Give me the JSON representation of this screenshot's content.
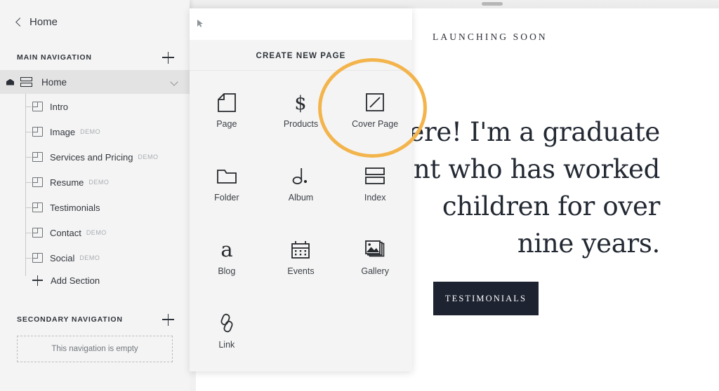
{
  "preview": {
    "eyebrow": "LAUNCHING SOON",
    "hero_lines": [
      "ere! I'm a graduate",
      "nt who has worked",
      " children for over",
      " nine years."
    ],
    "cta_label": "TESTIMONIALS",
    "cta_bg": "#1d2330"
  },
  "sidebar": {
    "back_label": "Home",
    "main_nav_title": "MAIN NAVIGATION",
    "add_main_nav_icon": "plus-icon",
    "home_item": {
      "label": "Home",
      "home_icon": "home-icon",
      "type_icon": "index-icon",
      "chevron": "chevron-down-icon"
    },
    "pages": [
      {
        "label": "Intro",
        "badge": ""
      },
      {
        "label": "Image",
        "badge": "DEMO"
      },
      {
        "label": "Services and Pricing",
        "badge": "DEMO"
      },
      {
        "label": "Resume",
        "badge": "DEMO"
      },
      {
        "label": "Testimonials",
        "badge": ""
      },
      {
        "label": "Contact",
        "badge": "DEMO"
      },
      {
        "label": "Social",
        "badge": "DEMO"
      }
    ],
    "add_section_label": "Add Section",
    "secondary_nav_title": "SECONDARY NAVIGATION",
    "add_secondary_nav_icon": "plus-icon",
    "empty_message": "This navigation is empty"
  },
  "panel": {
    "title": "CREATE NEW PAGE",
    "cursor_icon": "cursor-arrow-icon",
    "highlight_color": "#f3b44c",
    "highlighted_tile": "Cover Page",
    "tiles": [
      {
        "label": "Page",
        "icon": "page-icon"
      },
      {
        "label": "Products",
        "icon": "dollar-icon"
      },
      {
        "label": "Cover Page",
        "icon": "cover-page-icon"
      },
      {
        "label": "Folder",
        "icon": "folder-icon"
      },
      {
        "label": "Album",
        "icon": "music-note-icon"
      },
      {
        "label": "Index",
        "icon": "index-icon"
      },
      {
        "label": "Blog",
        "icon": "letter-a-icon"
      },
      {
        "label": "Events",
        "icon": "calendar-icon"
      },
      {
        "label": "Gallery",
        "icon": "gallery-icon"
      },
      {
        "label": "Link",
        "icon": "link-icon"
      }
    ]
  }
}
